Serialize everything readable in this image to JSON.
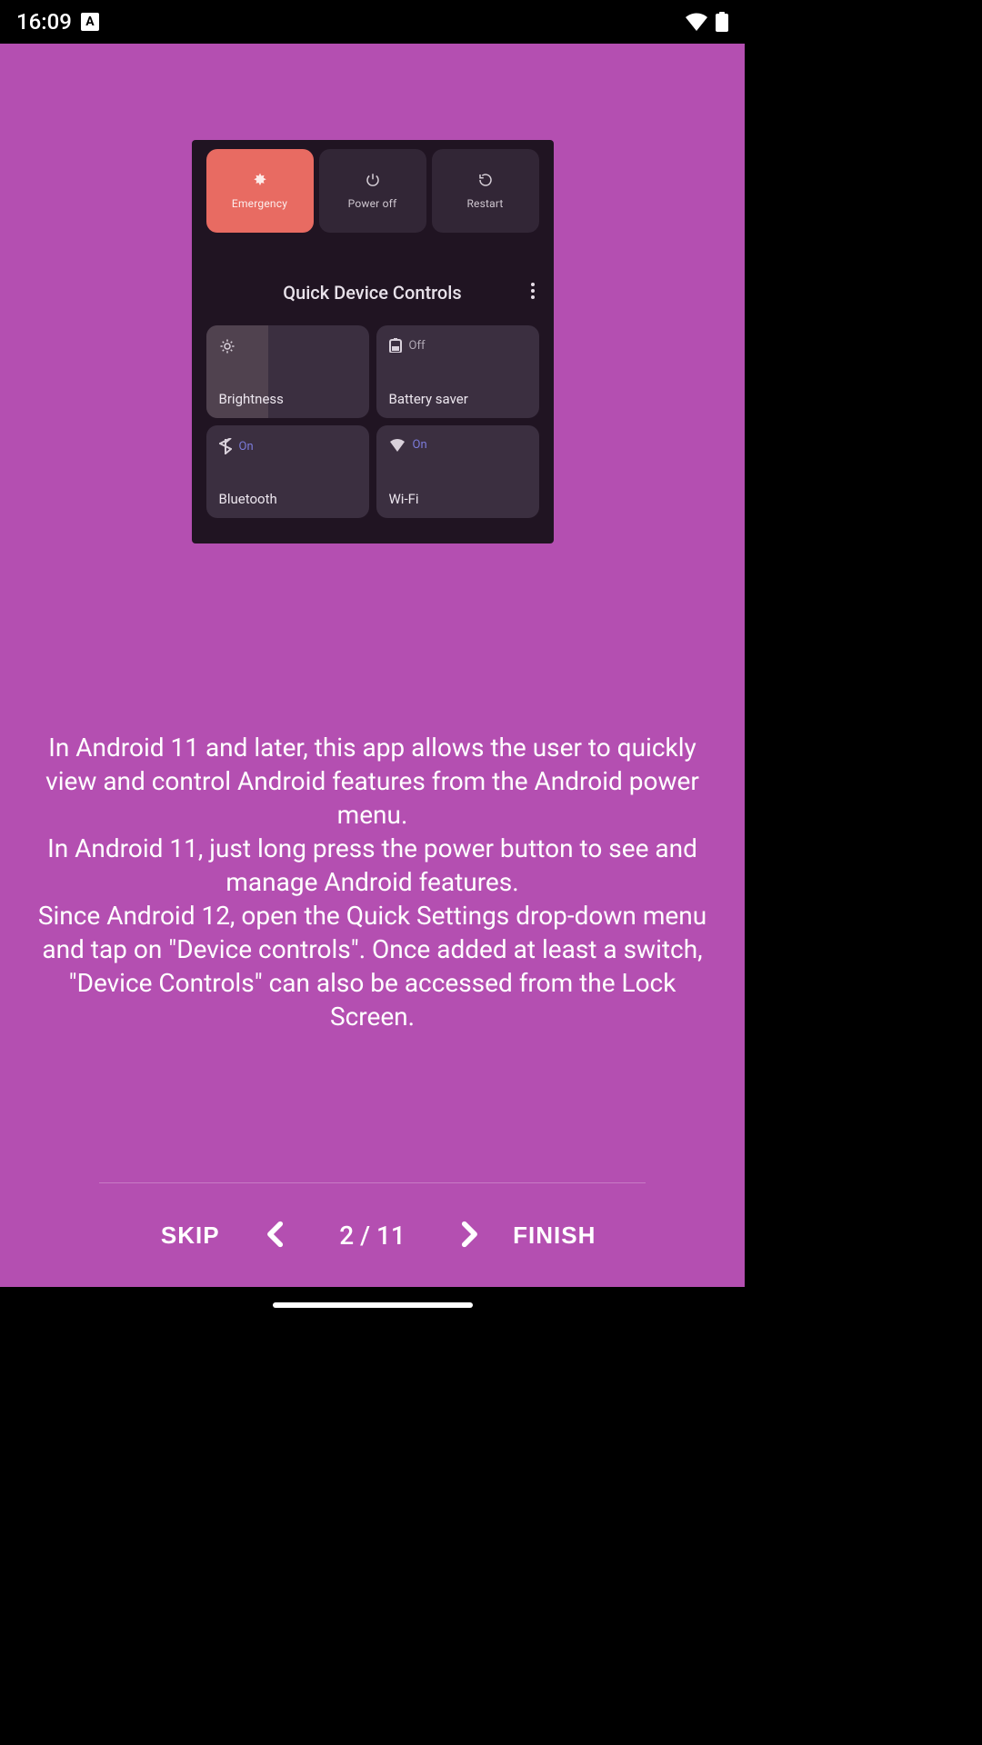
{
  "status_bar": {
    "time": "16:09",
    "a_icon_label": "A"
  },
  "illustration": {
    "top_tiles": [
      {
        "label": "Emergency"
      },
      {
        "label": "Power off"
      },
      {
        "label": "Restart"
      }
    ],
    "section_title": "Quick Device Controls",
    "bottom_tiles": {
      "brightness": {
        "label": "Brightness"
      },
      "battery_saver": {
        "state": "Off",
        "label": "Battery saver"
      },
      "bluetooth": {
        "state": "On",
        "label": "Bluetooth"
      },
      "wifi": {
        "state": "On",
        "label": "Wi-Fi"
      }
    }
  },
  "description": "In Android 11 and later, this app allows the user to quickly view and control Android features from the Android power menu.\nIn Android 11, just long press the power button to see and manage Android features.\nSince Android 12, open the Quick Settings drop-down menu and tap on \"Device controls\". Once added at least a switch, \"Device Controls\" can also be accessed from the Lock Screen.",
  "nav": {
    "skip_label": "SKIP",
    "finish_label": "FINISH",
    "page_current": 2,
    "page_total": 11,
    "page_indicator": "2 / 11"
  }
}
